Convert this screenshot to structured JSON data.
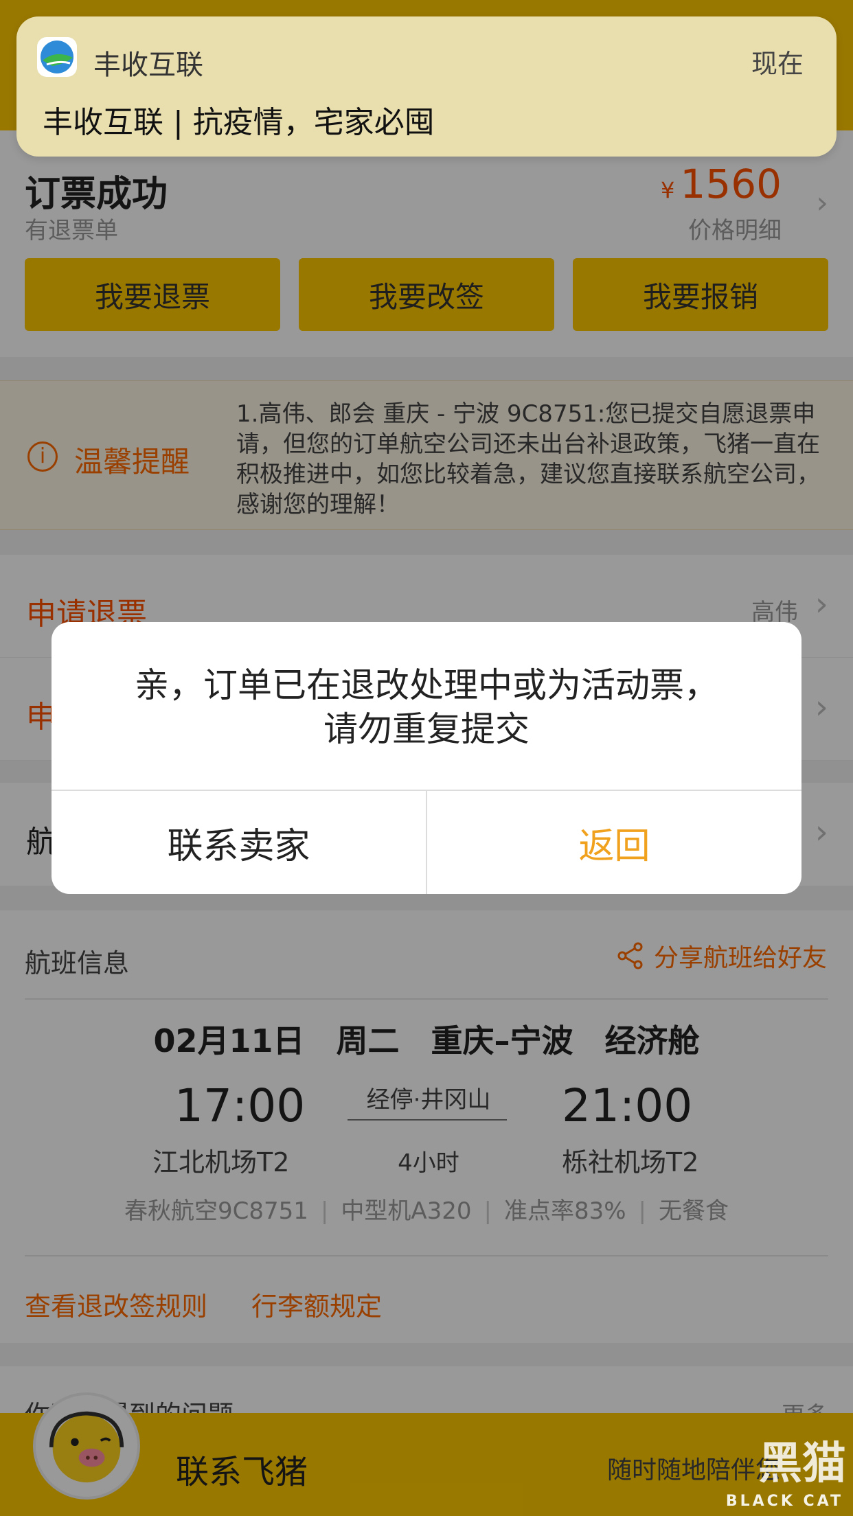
{
  "colors": {
    "brand_yellow": "#ffc900",
    "accent_orange": "#ff5000",
    "dialog_action": "#f0a11e"
  },
  "notification": {
    "app_name": "丰收互联",
    "time": "现在",
    "body": "丰收互联 | 抗疫情，宅家必囤",
    "icon": "app-logo-icon"
  },
  "order": {
    "status": "订票成功",
    "sub_status": "有退票单",
    "currency": "¥",
    "price": "1560",
    "price_detail": "价格明细"
  },
  "actions": [
    "我要退票",
    "我要改签",
    "我要报销"
  ],
  "notice": {
    "label": "温馨提醒",
    "text": "1.高伟、郎会 重庆 - 宁波 9C8751:您已提交自愿退票申请，但您的订单航空公司还未出台补退政策，飞猪一直在积极推进中，如您比较着急，建议您直接联系航空公司，感谢您的理解！"
  },
  "refund_rows": [
    {
      "title": "申请退票",
      "value": "高伟"
    },
    {
      "title": "申",
      "value": ""
    }
  ],
  "flight_entry": {
    "title": "航"
  },
  "flight": {
    "section_title": "航班信息",
    "share_label": "分享航班给好友",
    "date": "02月11日 周二",
    "route": "重庆–宁波",
    "cabin": "经济舱",
    "dep_time": "17:00",
    "dep_airport": "江北机场T2",
    "stopover": "经停·井冈山",
    "duration": "4小时",
    "arr_time": "21:00",
    "arr_airport": "栎社机场T2",
    "airline": "春秋航空9C8751",
    "aircraft": "中型机A320",
    "on_time": "准点率83%",
    "meal": "无餐食",
    "link_rules": "查看退改签规则",
    "link_baggage": "行李额规定"
  },
  "problems": {
    "title": "你可能遇到的问题",
    "more": "更多"
  },
  "bottom": {
    "contact": "联系飞猪",
    "sub": "随时随地陪伴您",
    "watermark": "黑猫",
    "watermark_sub": "BLACK CAT"
  },
  "dialog": {
    "line1": "亲，订单已在退改处理中或为活动票，",
    "line2": "请勿重复提交",
    "contact_seller": "联系卖家",
    "back": "返回"
  }
}
